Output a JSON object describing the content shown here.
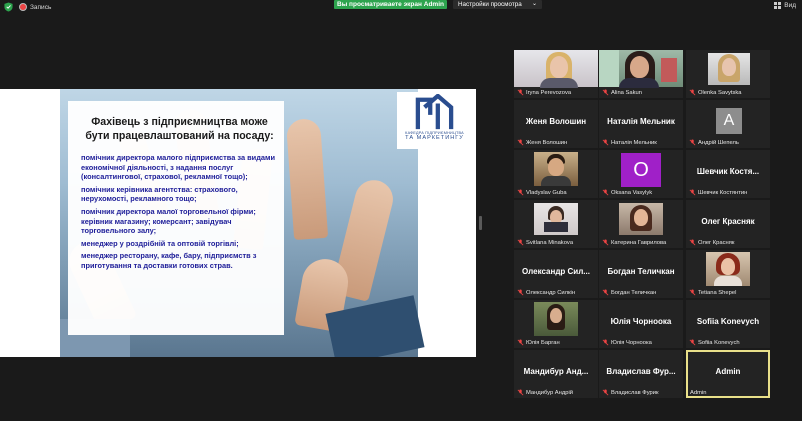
{
  "topbar": {
    "record_label": "Запись",
    "share_banner": "Вы просматриваете экран Admin",
    "view_options_label": "Настройки просмотра",
    "view_label": "Вид"
  },
  "slide": {
    "title": "Фахівець з підприємництва може бути працевлаштований на посаду:",
    "bullets": [
      "помічник директора малого підприємства за видами економічної діяльності, з надання послуг (консалтингової, страхової, рекламної тощо);",
      "помічник керівника агентства: страхового, нерухомості, рекламного тощо;",
      "помічник директора малої торговельної фірми; керівник магазину; комерсант; завідувач торговельного залу;",
      "менеджер у роздрібній та оптовій торгівлі;",
      "менеджер ресторану, кафе, бару, підприємств з приготування та доставки готових страв."
    ],
    "logo_line1": "КАФЕДРА ПІДПРИЄМНИЦТВА",
    "logo_line2": "ТА МАРКЕТИНГУ"
  },
  "participants": [
    {
      "name": "Iryna Perevozova",
      "display": "",
      "muted": true
    },
    {
      "name": "Alina Sakun",
      "display": "",
      "muted": true
    },
    {
      "name": "Olenka Savytska",
      "display": "",
      "muted": true
    },
    {
      "name": "Женя Волошин",
      "display": "Женя Волошин",
      "muted": true
    },
    {
      "name": "Наталія Мельник",
      "display": "Наталія Мельник",
      "muted": true
    },
    {
      "name": "Андрій Шепель",
      "display": "",
      "avatar": "A",
      "muted": true
    },
    {
      "name": "Vladyslav Guba",
      "display": "",
      "muted": true
    },
    {
      "name": "Oksana Vasylyk",
      "display": "",
      "avatar": "O",
      "muted": true
    },
    {
      "name": "Шевчик Костянтин",
      "display": "Шевчик Костя...",
      "muted": true
    },
    {
      "name": "Svitlana Minakova",
      "display": "",
      "muted": true
    },
    {
      "name": "Катерина Гаврилова",
      "display": "",
      "muted": true
    },
    {
      "name": "Олег Красняк",
      "display": "Олег Красняк",
      "muted": true
    },
    {
      "name": "Олександр Силкін",
      "display": "Олександр Сил...",
      "muted": true
    },
    {
      "name": "Богдан Теличкан",
      "display": "Богдан Теличкан",
      "muted": true
    },
    {
      "name": "Tetiana Shepel",
      "display": "",
      "muted": true
    },
    {
      "name": "Юлія Барган",
      "display": "",
      "muted": true
    },
    {
      "name": "Юлія Чорноока",
      "display": "Юлія Чорноока",
      "muted": true
    },
    {
      "name": "Sofiia Konevych",
      "display": "Sofiia Konevych",
      "muted": true
    },
    {
      "name": "Мандибур Андрій",
      "display": "Мандибур Анд...",
      "muted": true
    },
    {
      "name": "Владислав Фурик",
      "display": "Владислав Фур...",
      "muted": true
    },
    {
      "name": "Admin",
      "display": "Admin",
      "muted": false
    }
  ],
  "colors": {
    "share_green": "#2da44e",
    "active_speaker": "#e9e08a",
    "bullet_text": "#20209a",
    "avatar_grey": "#8d8d8d",
    "avatar_purple": "#a020c8"
  }
}
